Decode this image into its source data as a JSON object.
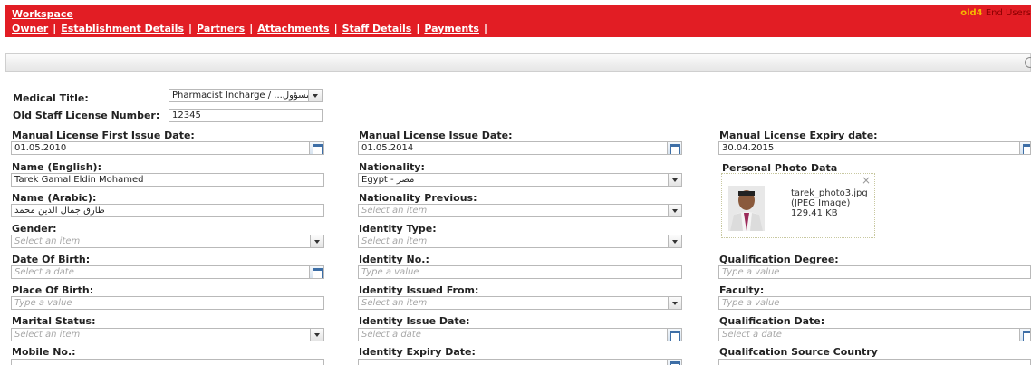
{
  "header": {
    "workspace_label": "Workspace",
    "nav": [
      "Owner",
      "Establishment Details",
      "Partners",
      "Attachments",
      "Staff Details",
      "Payments"
    ],
    "user_name": "old4",
    "user_link": "End Users"
  },
  "form": {
    "medical_title": {
      "label": "Medical Title:",
      "value": "Pharmacist Incharge / ...لي مسؤول"
    },
    "old_staff_license": {
      "label": "Old Staff License Number:",
      "value": "12345"
    },
    "manual_first_issue": {
      "label": "Manual License First Issue Date:",
      "value": "01.05.2010"
    },
    "manual_issue": {
      "label": "Manual License Issue Date:",
      "value": "01.05.2014"
    },
    "manual_expiry": {
      "label": "Manual License Expiry date:",
      "value": "30.04.2015"
    },
    "name_english": {
      "label": "Name (English):",
      "value": "Tarek Gamal Eldin Mohamed"
    },
    "nationality": {
      "label": "Nationality:",
      "value": "Egypt - مصر"
    },
    "photo_label": "Personal Photo Data",
    "name_arabic": {
      "label": "Name (Arabic):",
      "value": "طارق جمال الدين محمد"
    },
    "nationality_previous": {
      "label": "Nationality Previous:",
      "placeholder": "Select an item"
    },
    "gender": {
      "label": "Gender:",
      "placeholder": "Select an item"
    },
    "identity_type": {
      "label": "Identity Type:",
      "placeholder": "Select an item"
    },
    "date_of_birth": {
      "label": "Date Of Birth:",
      "placeholder": "Select a date"
    },
    "identity_no": {
      "label": "Identity No.:",
      "placeholder": "Type a value"
    },
    "qualification_degree": {
      "label": "Qualification Degree:",
      "placeholder": "Type a value"
    },
    "place_of_birth": {
      "label": "Place Of Birth:",
      "placeholder": "Type a value"
    },
    "identity_issued_from": {
      "label": "Identity Issued From:",
      "placeholder": "Select an item"
    },
    "faculty": {
      "label": "Faculty:",
      "placeholder": "Type a value"
    },
    "marital_status": {
      "label": "Marital Status:",
      "placeholder": "Select an item"
    },
    "identity_issue_date": {
      "label": "Identity Issue Date:",
      "placeholder": "Select a date"
    },
    "qualification_date": {
      "label": "Qualification Date:",
      "placeholder": "Select a date"
    },
    "mobile_no": {
      "label": "Mobile No.:"
    },
    "identity_expiry_date": {
      "label": "Identity Expiry Date:"
    },
    "qualification_source_country": {
      "label": "Qualifcation Source Country"
    }
  },
  "photo": {
    "filename": "tarek_photo3.jpg",
    "type": "(JPEG Image)",
    "size": "129.41 KB"
  }
}
